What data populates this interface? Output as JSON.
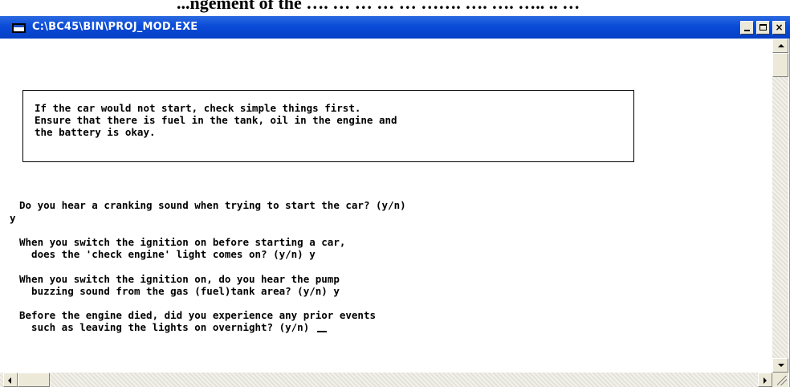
{
  "background": {
    "heading": "...ngement of the …. … … … … ……. …. …. ….. .. …"
  },
  "window": {
    "title": "C:\\BC45\\BIN\\PROJ_MOD.EXE",
    "controls": {
      "minimize": "_",
      "maximize": "□",
      "close": "×"
    }
  },
  "console": {
    "box_lines": [
      "If the car would not start, check simple things first.",
      "Ensure that there is fuel in the tank, oil in the engine and",
      "the battery is okay."
    ],
    "q1": "Do you hear a cranking sound when trying to start the car? (y/n)",
    "a1": "y",
    "q2_line1": "When you switch the ignition on before starting a car,",
    "q2_line2": "  does the 'check engine' light comes on? (y/n) y",
    "q3_line1": "When you switch the ignition on, do you hear the pump",
    "q3_line2": "  buzzing sound from the gas (fuel)tank area? (y/n) y",
    "q4_line1": "Before the engine died, did you experience any prior events",
    "q4_line2": "  such as leaving the lights on overnight? (y/n) "
  },
  "colors": {
    "titlebar": "#0a4bd8",
    "title_text": "#ffffff",
    "console_bg": "#ffffff",
    "console_text": "#000000"
  }
}
